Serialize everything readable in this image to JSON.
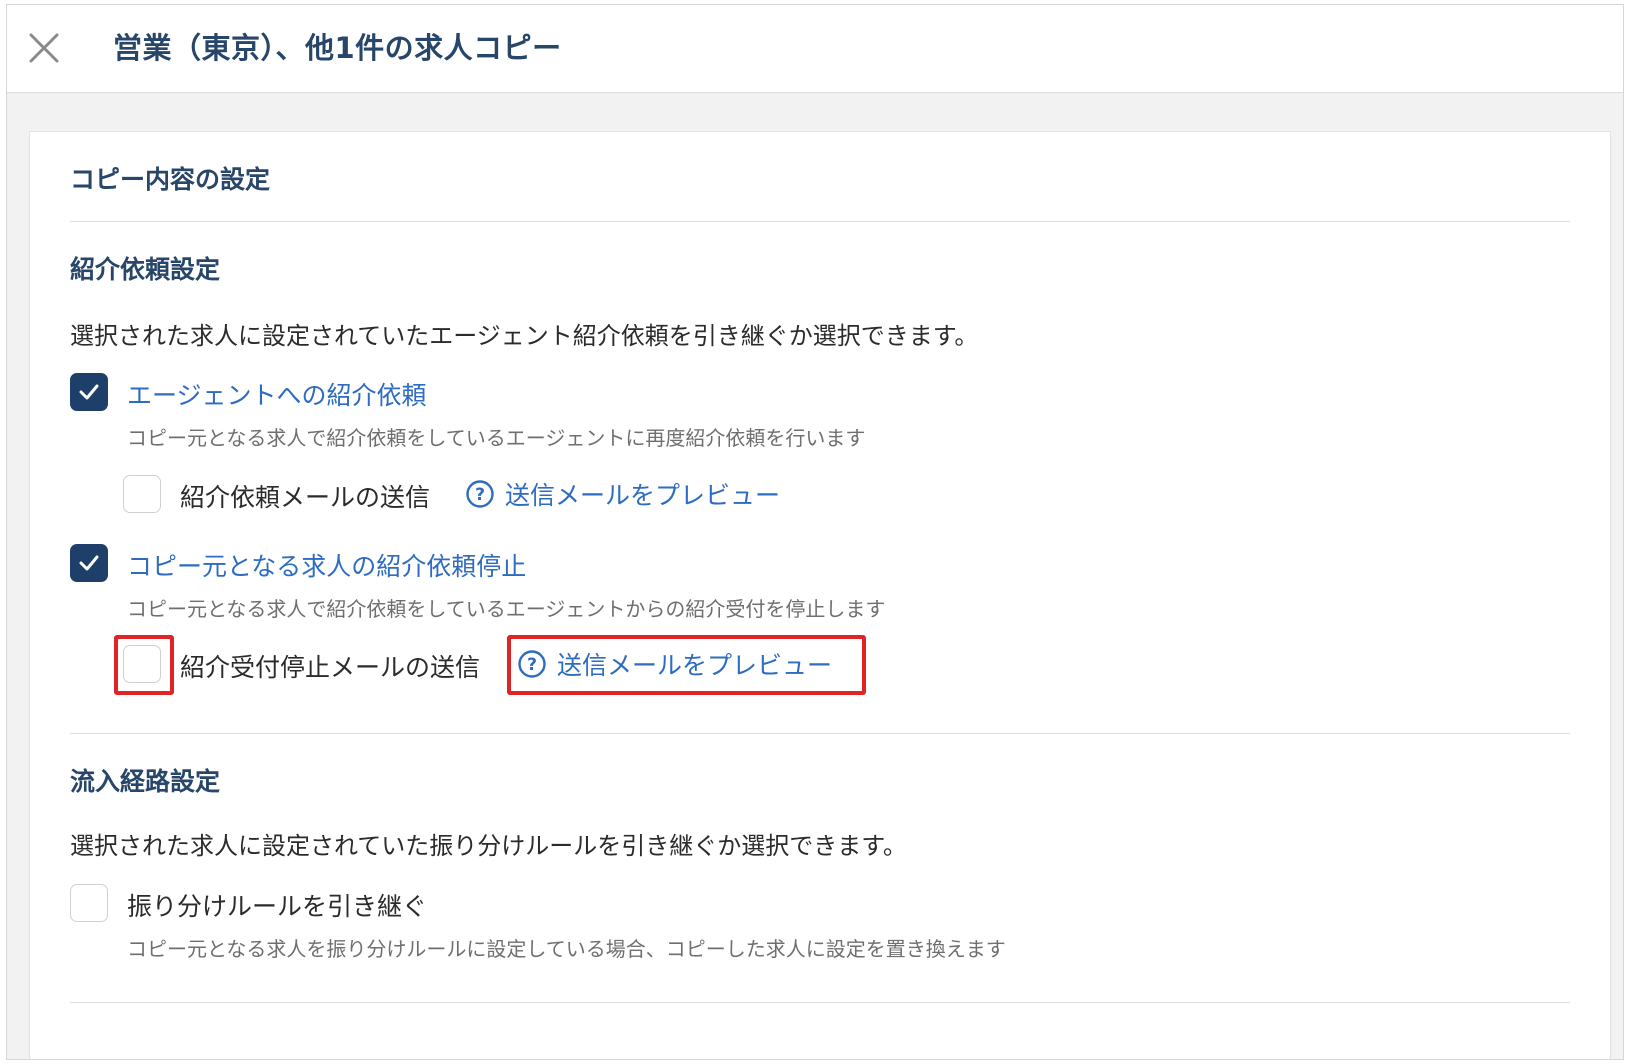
{
  "header": {
    "title": "営業（東京）、他1件の求人コピー",
    "close_icon": "close-icon"
  },
  "card": {
    "title": "コピー内容の設定",
    "referral_section": {
      "title": "紹介依頼設定",
      "description": "選択された求人に設定されていたエージェント紹介依頼を引き継ぐか選択できます。",
      "options": [
        {
          "label": "エージェントへの紹介依頼",
          "checked": true,
          "sublabel": "コピー元となる求人で紹介依頼をしているエージェントに再度紹介依頼を行います",
          "mail_option": {
            "label": "紹介依頼メールの送信",
            "checked": false,
            "preview_link": "送信メールをプレビュー"
          }
        },
        {
          "label": "コピー元となる求人の紹介依頼停止",
          "checked": true,
          "sublabel": "コピー元となる求人で紹介依頼をしているエージェントからの紹介受付を停止します",
          "mail_option": {
            "label": "紹介受付停止メールの送信",
            "checked": false,
            "preview_link": "送信メールをプレビュー"
          }
        }
      ]
    },
    "inflow_section": {
      "title": "流入経路設定",
      "description": "選択された求人に設定されていた振り分けルールを引き継ぐか選択できます。",
      "option": {
        "label": "振り分けルールを引き継ぐ",
        "checked": false,
        "sublabel": "コピー元となる求人を振り分けルールに設定している場合、コピーした求人に設定を置き換えます"
      }
    }
  },
  "colors": {
    "heading": "#27466a",
    "link": "#2d6cc0",
    "checkbox_checked": "#1f3f6b",
    "highlight": "#e02424"
  }
}
